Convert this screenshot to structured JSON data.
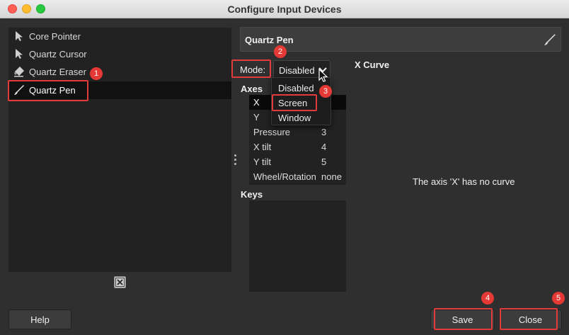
{
  "window": {
    "title": "Configure Input Devices"
  },
  "devices": [
    {
      "label": "Core Pointer",
      "icon": "arrow-pointer-icon"
    },
    {
      "label": "Quartz Cursor",
      "icon": "arrow-pointer-icon"
    },
    {
      "label": "Quartz Eraser",
      "icon": "eraser-icon"
    },
    {
      "label": "Quartz Pen",
      "icon": "pen-icon",
      "selected": true
    }
  ],
  "device_panel": {
    "name": "Quartz Pen",
    "mode_label": "Mode:",
    "mode_value": "Disabled",
    "mode_options": [
      "Disabled",
      "Screen",
      "Window"
    ],
    "axes_title": "Axes",
    "axes": [
      {
        "name": "X",
        "value": ""
      },
      {
        "name": "Y",
        "value": ""
      },
      {
        "name": "Pressure",
        "value": "3"
      },
      {
        "name": "X tilt",
        "value": "4"
      },
      {
        "name": "Y tilt",
        "value": "5"
      },
      {
        "name": "Wheel/Rotation",
        "value": "none"
      }
    ],
    "keys_title": "Keys",
    "curve_title": "X Curve",
    "curve_message": "The axis 'X' has no curve"
  },
  "buttons": {
    "help": "Help",
    "save": "Save",
    "close": "Close"
  },
  "annotations": [
    "1",
    "2",
    "3",
    "4",
    "5"
  ],
  "colors": {
    "highlight": "#e23b3b",
    "badge": "#e53935",
    "background": "#2f2f2f"
  }
}
